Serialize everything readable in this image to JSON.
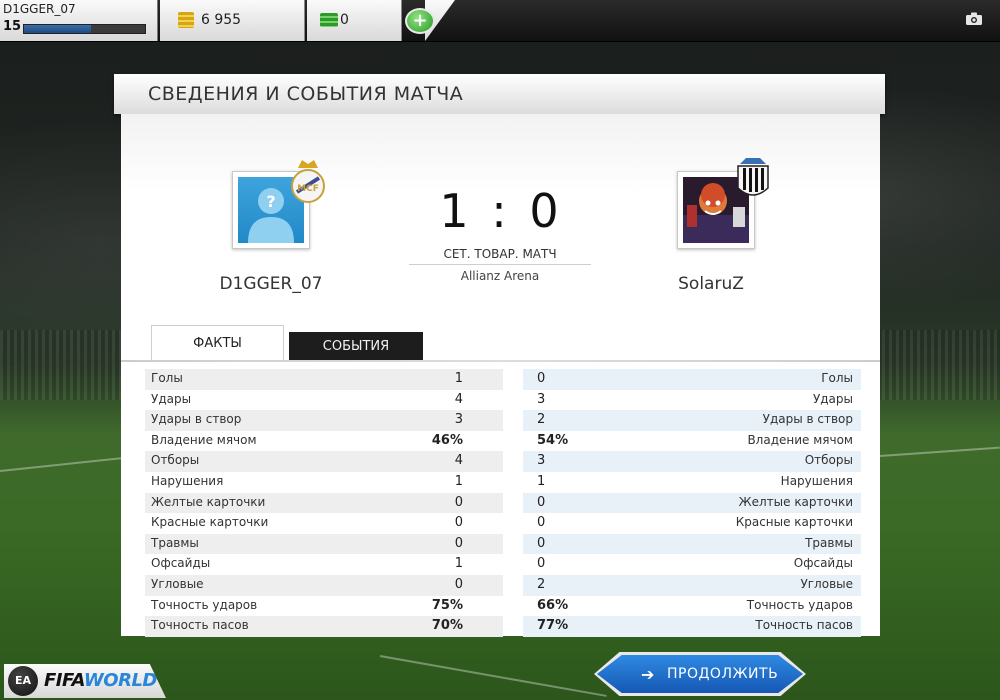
{
  "header": {
    "player_name": "D1GGER_07",
    "player_level": "15",
    "xp_progress": 0.55,
    "coins": "6 955",
    "fifa_points": "0",
    "add_label": "+"
  },
  "panel": {
    "title": "СВЕДЕНИЯ И СОБЫТИЯ МАТЧА"
  },
  "match": {
    "home_team": "D1GGER_07",
    "away_team": "SolaruZ",
    "score": "1 : 0",
    "match_type": "СЕТ. ТОВАР. МАТЧ",
    "venue": "Allianz Arena"
  },
  "tabs": {
    "facts": "ФАКТЫ",
    "events": "СОБЫТИЯ"
  },
  "stats": [
    {
      "label": "Голы",
      "home": "1",
      "away": "0"
    },
    {
      "label": "Удары",
      "home": "4",
      "away": "3"
    },
    {
      "label": "Удары в створ",
      "home": "3",
      "away": "2"
    },
    {
      "label": "Владение мячом",
      "home": "46%",
      "away": "54%"
    },
    {
      "label": "Отборы",
      "home": "4",
      "away": "3"
    },
    {
      "label": "Нарушения",
      "home": "1",
      "away": "1"
    },
    {
      "label": "Желтые карточки",
      "home": "0",
      "away": "0"
    },
    {
      "label": "Красные карточки",
      "home": "0",
      "away": "0"
    },
    {
      "label": "Травмы",
      "home": "0",
      "away": "0"
    },
    {
      "label": "Офсайды",
      "home": "1",
      "away": "0"
    },
    {
      "label": "Угловые",
      "home": "0",
      "away": "2"
    },
    {
      "label": "Точность ударов",
      "home": "75%",
      "away": "66%"
    },
    {
      "label": "Точность пасов",
      "home": "70%",
      "away": "77%"
    }
  ],
  "footer": {
    "logo_text_a": "FIFA",
    "logo_text_b": "WORLD",
    "ea_text": "EA",
    "continue_label": "ПРОДОЛЖИТЬ"
  },
  "colors": {
    "accent_blue": "#1f6fc9",
    "pitch_green": "#3a6a25"
  },
  "icons": [
    "coins-icon",
    "fifa-points-icon",
    "camera-icon",
    "avatar-placeholder-icon",
    "real-madrid-badge",
    "newcastle-badge",
    "arrow-right-icon",
    "ea-sports-logo"
  ]
}
